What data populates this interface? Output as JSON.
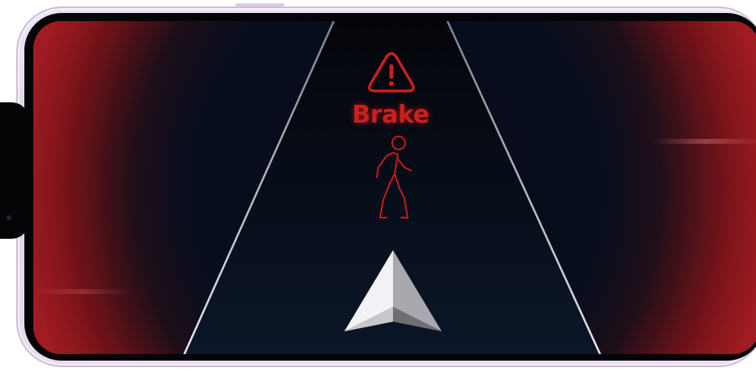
{
  "screen": {
    "alert": {
      "label": "Brake",
      "warning_icon": "warning-triangle-icon",
      "hazard_icon": "pedestrian-walking-icon"
    },
    "navigation": {
      "position_icon": "navigation-arrow-icon"
    }
  },
  "colors": {
    "alert_red": "#c9201f",
    "road_edge": "#c8ccd6",
    "arrow_silver": "#d8d8dc",
    "edge_glow": "#9a1d22"
  }
}
